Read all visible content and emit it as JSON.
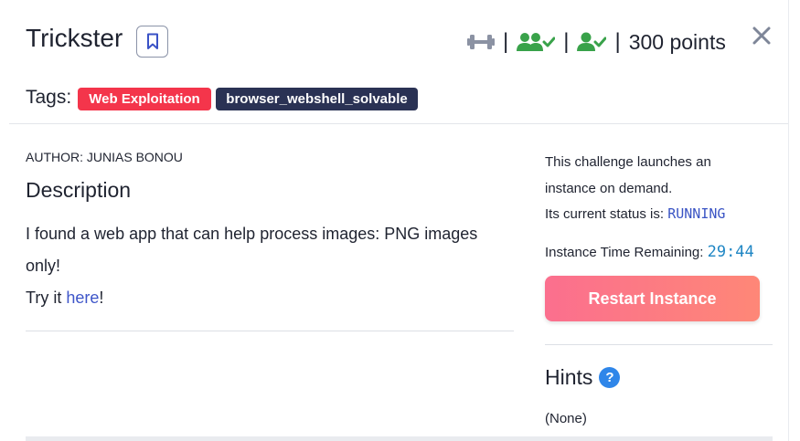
{
  "challenge": {
    "title": "Trickster",
    "points": "300 points",
    "separator": "|"
  },
  "icons": {
    "bookmark": "bookmark-icon",
    "difficulty": "dumbbell-icon",
    "team_solves": "users-check-icon",
    "user_solved": "user-check-icon",
    "close": "close-icon",
    "hint_help": "question-circle-icon"
  },
  "tags": {
    "label": "Tags:",
    "items": [
      "Web Exploitation",
      "browser_webshell_solvable"
    ]
  },
  "main": {
    "author": "AUTHOR: JUNIAS BONOU",
    "description_heading": "Description",
    "description_line1": "I found a web app that can help process images: PNG images only!",
    "try_prefix": "Try it ",
    "try_link": "here",
    "try_suffix": "!"
  },
  "instance": {
    "intro": "This challenge launches an instance on demand.",
    "status_label": "Its current status is: ",
    "status_value": "RUNNING",
    "time_label": "Instance Time Remaining: ",
    "time_value": "29:44",
    "restart_label": "Restart Instance"
  },
  "hints": {
    "heading": "Hints",
    "help_glyph": "?",
    "content": "(None)"
  },
  "colors": {
    "accent_green": "#39a24a",
    "tag_red": "#f4354b",
    "tag_navy": "#2a3254",
    "link": "#3e56c9",
    "timer": "#1f86c4",
    "button_start": "#fb6f8e",
    "button_end": "#fe8777",
    "help_blue": "#2f86e9"
  }
}
